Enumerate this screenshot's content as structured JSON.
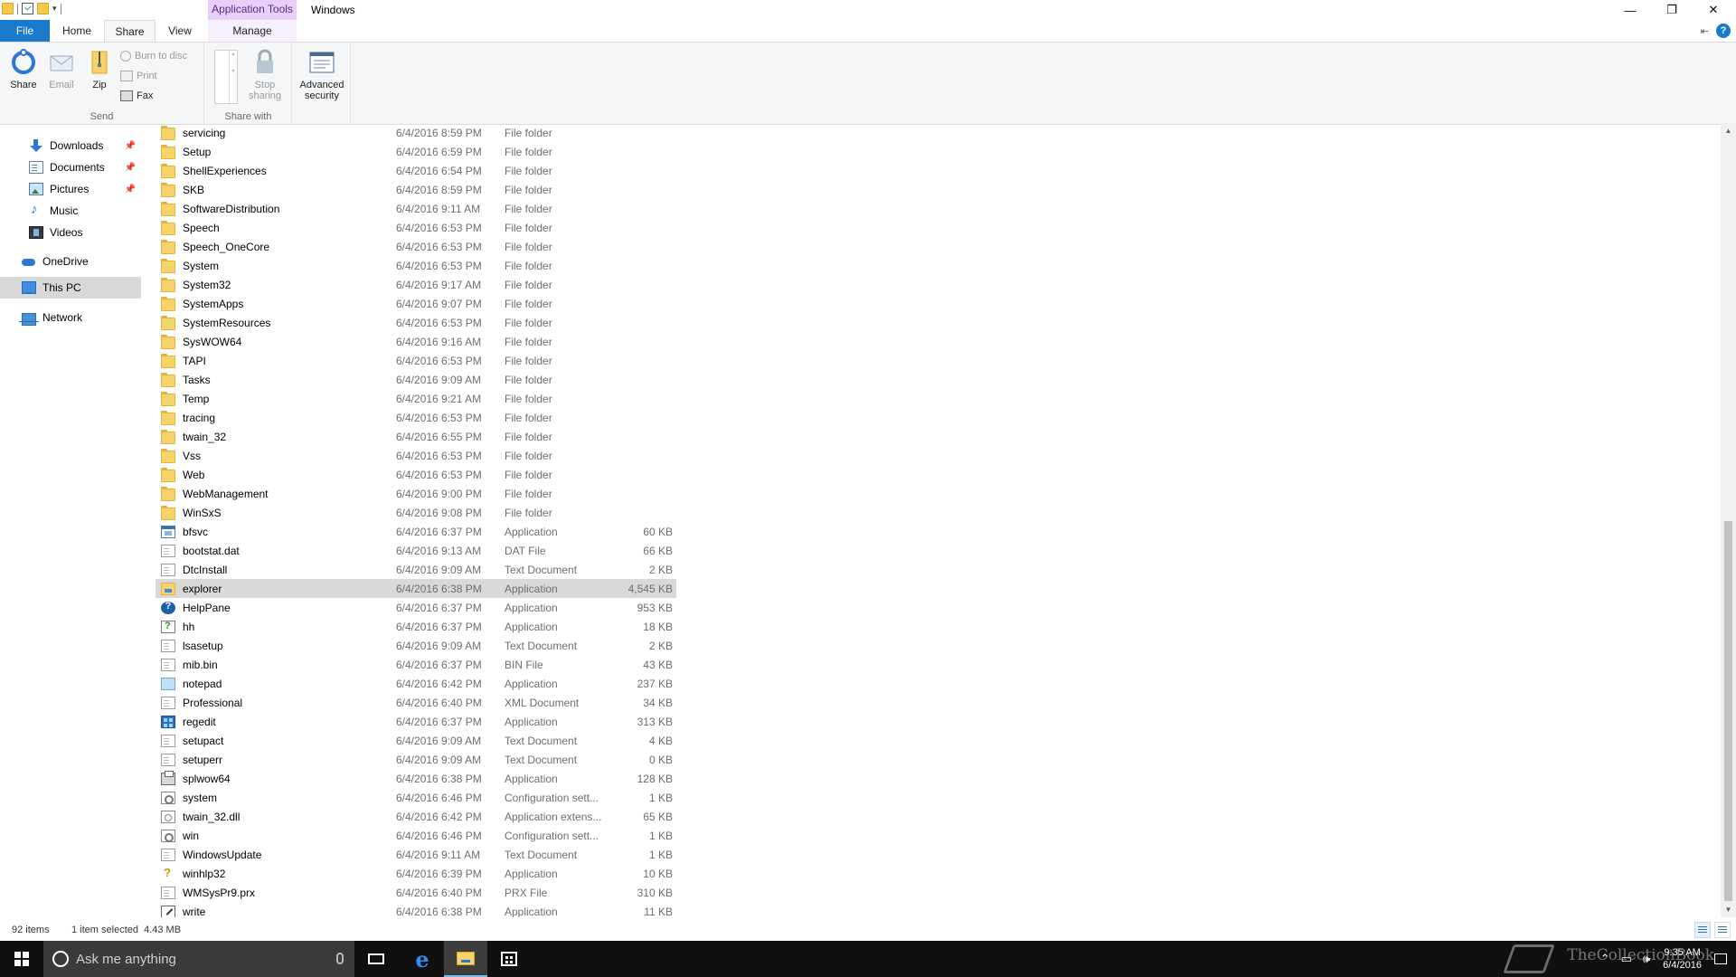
{
  "titlebar": {
    "context_tab_label": "Application Tools",
    "window_title": "Windows",
    "minimize": "—",
    "restore": "❐",
    "close": "✕"
  },
  "ribbon_tabs": {
    "file": "File",
    "home": "Home",
    "share": "Share",
    "view": "View",
    "manage": "Manage"
  },
  "ribbon": {
    "send_group": {
      "label": "Send",
      "share": "Share",
      "email": "Email",
      "zip": "Zip",
      "burn": "Burn to disc",
      "print": "Print",
      "fax": "Fax"
    },
    "share_with_group": {
      "label": "Share with",
      "stop_sharing_line1": "Stop",
      "stop_sharing_line2": "sharing"
    },
    "advanced_security_line1": "Advanced",
    "advanced_security_line2": "security"
  },
  "nav": {
    "items": [
      {
        "label": "Downloads",
        "icon": "downloads-icon",
        "pinned": true
      },
      {
        "label": "Documents",
        "icon": "documents-icon",
        "pinned": true
      },
      {
        "label": "Pictures",
        "icon": "pictures-icon",
        "pinned": true
      },
      {
        "label": "Music",
        "icon": "music-icon",
        "pinned": false
      },
      {
        "label": "Videos",
        "icon": "videos-icon",
        "pinned": false
      },
      {
        "label": "OneDrive",
        "icon": "onedrive-icon",
        "pinned": false
      },
      {
        "label": "This PC",
        "icon": "this-pc-icon",
        "pinned": false,
        "selected": true
      },
      {
        "label": "Network",
        "icon": "network-icon",
        "pinned": false
      }
    ],
    "pin_glyph": "📌"
  },
  "files": [
    {
      "name": "servicing",
      "date": "6/4/2016 8:59 PM",
      "type": "File folder",
      "size": "",
      "icon": "folder"
    },
    {
      "name": "Setup",
      "date": "6/4/2016 6:59 PM",
      "type": "File folder",
      "size": "",
      "icon": "folder"
    },
    {
      "name": "ShellExperiences",
      "date": "6/4/2016 6:54 PM",
      "type": "File folder",
      "size": "",
      "icon": "folder"
    },
    {
      "name": "SKB",
      "date": "6/4/2016 8:59 PM",
      "type": "File folder",
      "size": "",
      "icon": "folder"
    },
    {
      "name": "SoftwareDistribution",
      "date": "6/4/2016 9:11 AM",
      "type": "File folder",
      "size": "",
      "icon": "folder"
    },
    {
      "name": "Speech",
      "date": "6/4/2016 6:53 PM",
      "type": "File folder",
      "size": "",
      "icon": "folder"
    },
    {
      "name": "Speech_OneCore",
      "date": "6/4/2016 6:53 PM",
      "type": "File folder",
      "size": "",
      "icon": "folder"
    },
    {
      "name": "System",
      "date": "6/4/2016 6:53 PM",
      "type": "File folder",
      "size": "",
      "icon": "folder"
    },
    {
      "name": "System32",
      "date": "6/4/2016 9:17 AM",
      "type": "File folder",
      "size": "",
      "icon": "folder"
    },
    {
      "name": "SystemApps",
      "date": "6/4/2016 9:07 PM",
      "type": "File folder",
      "size": "",
      "icon": "folder"
    },
    {
      "name": "SystemResources",
      "date": "6/4/2016 6:53 PM",
      "type": "File folder",
      "size": "",
      "icon": "folder"
    },
    {
      "name": "SysWOW64",
      "date": "6/4/2016 9:16 AM",
      "type": "File folder",
      "size": "",
      "icon": "folder"
    },
    {
      "name": "TAPI",
      "date": "6/4/2016 6:53 PM",
      "type": "File folder",
      "size": "",
      "icon": "folder"
    },
    {
      "name": "Tasks",
      "date": "6/4/2016 9:09 AM",
      "type": "File folder",
      "size": "",
      "icon": "folder"
    },
    {
      "name": "Temp",
      "date": "6/4/2016 9:21 AM",
      "type": "File folder",
      "size": "",
      "icon": "folder"
    },
    {
      "name": "tracing",
      "date": "6/4/2016 6:53 PM",
      "type": "File folder",
      "size": "",
      "icon": "folder"
    },
    {
      "name": "twain_32",
      "date": "6/4/2016 6:55 PM",
      "type": "File folder",
      "size": "",
      "icon": "folder"
    },
    {
      "name": "Vss",
      "date": "6/4/2016 6:53 PM",
      "type": "File folder",
      "size": "",
      "icon": "folder"
    },
    {
      "name": "Web",
      "date": "6/4/2016 6:53 PM",
      "type": "File folder",
      "size": "",
      "icon": "folder"
    },
    {
      "name": "WebManagement",
      "date": "6/4/2016 9:00 PM",
      "type": "File folder",
      "size": "",
      "icon": "folder"
    },
    {
      "name": "WinSxS",
      "date": "6/4/2016 9:08 PM",
      "type": "File folder",
      "size": "",
      "icon": "folder"
    },
    {
      "name": "bfsvc",
      "date": "6/4/2016 6:37 PM",
      "type": "Application",
      "size": "60 KB",
      "icon": "app"
    },
    {
      "name": "bootstat.dat",
      "date": "6/4/2016 9:13 AM",
      "type": "DAT File",
      "size": "66 KB",
      "icon": "doc"
    },
    {
      "name": "DtcInstall",
      "date": "6/4/2016 9:09 AM",
      "type": "Text Document",
      "size": "2 KB",
      "icon": "doc"
    },
    {
      "name": "explorer",
      "date": "6/4/2016 6:38 PM",
      "type": "Application",
      "size": "4,545 KB",
      "icon": "explorer",
      "selected": true
    },
    {
      "name": "HelpPane",
      "date": "6/4/2016 6:37 PM",
      "type": "Application",
      "size": "953 KB",
      "icon": "help"
    },
    {
      "name": "hh",
      "date": "6/4/2016 6:37 PM",
      "type": "Application",
      "size": "18 KB",
      "icon": "hh"
    },
    {
      "name": "lsasetup",
      "date": "6/4/2016 9:09 AM",
      "type": "Text Document",
      "size": "2 KB",
      "icon": "doc"
    },
    {
      "name": "mib.bin",
      "date": "6/4/2016 6:37 PM",
      "type": "BIN File",
      "size": "43 KB",
      "icon": "doc"
    },
    {
      "name": "notepad",
      "date": "6/4/2016 6:42 PM",
      "type": "Application",
      "size": "237 KB",
      "icon": "notepad"
    },
    {
      "name": "Professional",
      "date": "6/4/2016 6:40 PM",
      "type": "XML Document",
      "size": "34 KB",
      "icon": "doc"
    },
    {
      "name": "regedit",
      "date": "6/4/2016 6:37 PM",
      "type": "Application",
      "size": "313 KB",
      "icon": "regedit"
    },
    {
      "name": "setupact",
      "date": "6/4/2016 9:09 AM",
      "type": "Text Document",
      "size": "4 KB",
      "icon": "doc"
    },
    {
      "name": "setuperr",
      "date": "6/4/2016 9:09 AM",
      "type": "Text Document",
      "size": "0 KB",
      "icon": "doc"
    },
    {
      "name": "splwow64",
      "date": "6/4/2016 6:38 PM",
      "type": "Application",
      "size": "128 KB",
      "icon": "print"
    },
    {
      "name": "system",
      "date": "6/4/2016 6:46 PM",
      "type": "Configuration sett...",
      "size": "1 KB",
      "icon": "config"
    },
    {
      "name": "twain_32.dll",
      "date": "6/4/2016 6:42 PM",
      "type": "Application extens...",
      "size": "65 KB",
      "icon": "dll"
    },
    {
      "name": "win",
      "date": "6/4/2016 6:46 PM",
      "type": "Configuration sett...",
      "size": "1 KB",
      "icon": "config"
    },
    {
      "name": "WindowsUpdate",
      "date": "6/4/2016 9:11 AM",
      "type": "Text Document",
      "size": "1 KB",
      "icon": "doc"
    },
    {
      "name": "winhlp32",
      "date": "6/4/2016 6:39 PM",
      "type": "Application",
      "size": "10 KB",
      "icon": "winhlp"
    },
    {
      "name": "WMSysPr9.prx",
      "date": "6/4/2016 6:40 PM",
      "type": "PRX File",
      "size": "310 KB",
      "icon": "doc"
    },
    {
      "name": "write",
      "date": "6/4/2016 6:38 PM",
      "type": "Application",
      "size": "11 KB",
      "icon": "write"
    }
  ],
  "status": {
    "item_count": "92 items",
    "selection": "1 item selected  4.43 MB"
  },
  "taskbar": {
    "search_placeholder": "Ask me anything",
    "clock_time": "9:35 AM",
    "clock_date": "6/4/2016",
    "watermark": "TheCollectionBook"
  }
}
